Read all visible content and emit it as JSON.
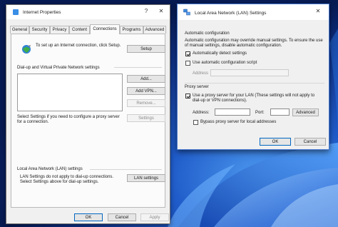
{
  "internet_properties": {
    "title": "Internet Properties",
    "help_glyph": "?",
    "close_glyph": "✕",
    "tabs": [
      {
        "label": "General",
        "active": false
      },
      {
        "label": "Security",
        "active": false
      },
      {
        "label": "Privacy",
        "active": false
      },
      {
        "label": "Content",
        "active": false
      },
      {
        "label": "Connections",
        "active": true
      },
      {
        "label": "Programs",
        "active": false
      },
      {
        "label": "Advanced",
        "active": false
      }
    ],
    "setup_text": "To set up an Internet connection, click Setup.",
    "setup_button": "Setup",
    "dialup_heading": "Dial-up and Virtual Private Network settings",
    "add_button": "Add...",
    "add_vpn_button": "Add VPN...",
    "remove_button": "Remove...",
    "settings_text": "Select Settings if you need to configure a proxy server for a connection.",
    "settings_button": "Settings",
    "lan_heading": "Local Area Network (LAN) settings",
    "lan_text": "LAN Settings do not apply to dial-up connections. Select Settings above for dial-up settings.",
    "lan_settings_button": "LAN settings",
    "ok_button": "OK",
    "cancel_button": "Cancel",
    "apply_button": "Apply"
  },
  "lan_dialog": {
    "title": "Local Area Network (LAN) Settings",
    "close_glyph": "✕",
    "auto_config_heading": "Automatic configuration",
    "auto_config_desc": "Automatic configuration may override manual settings. To ensure the use of manual settings, disable automatic configuration.",
    "auto_detect_label": "Automatically detect settings",
    "auto_detect_checked": true,
    "auto_script_label": "Use automatic configuration script",
    "auto_script_checked": false,
    "address_label": "Address",
    "address_value": "",
    "proxy_heading": "Proxy server",
    "use_proxy_label": "Use a proxy server for your LAN (These settings will not apply to dial-up or VPN connections).",
    "use_proxy_checked": true,
    "proxy_address_label": "Address:",
    "proxy_address_value": "",
    "port_label": "Port:",
    "port_value": "",
    "advanced_button": "Advanced",
    "bypass_label": "Bypass proxy server for local addresses",
    "bypass_checked": false,
    "ok_button": "OK",
    "cancel_button": "Cancel"
  },
  "colors": {
    "accent": "#0067c0",
    "wallpaper_dark": "#0a1e5e",
    "wallpaper_light": "#3f8bea"
  }
}
